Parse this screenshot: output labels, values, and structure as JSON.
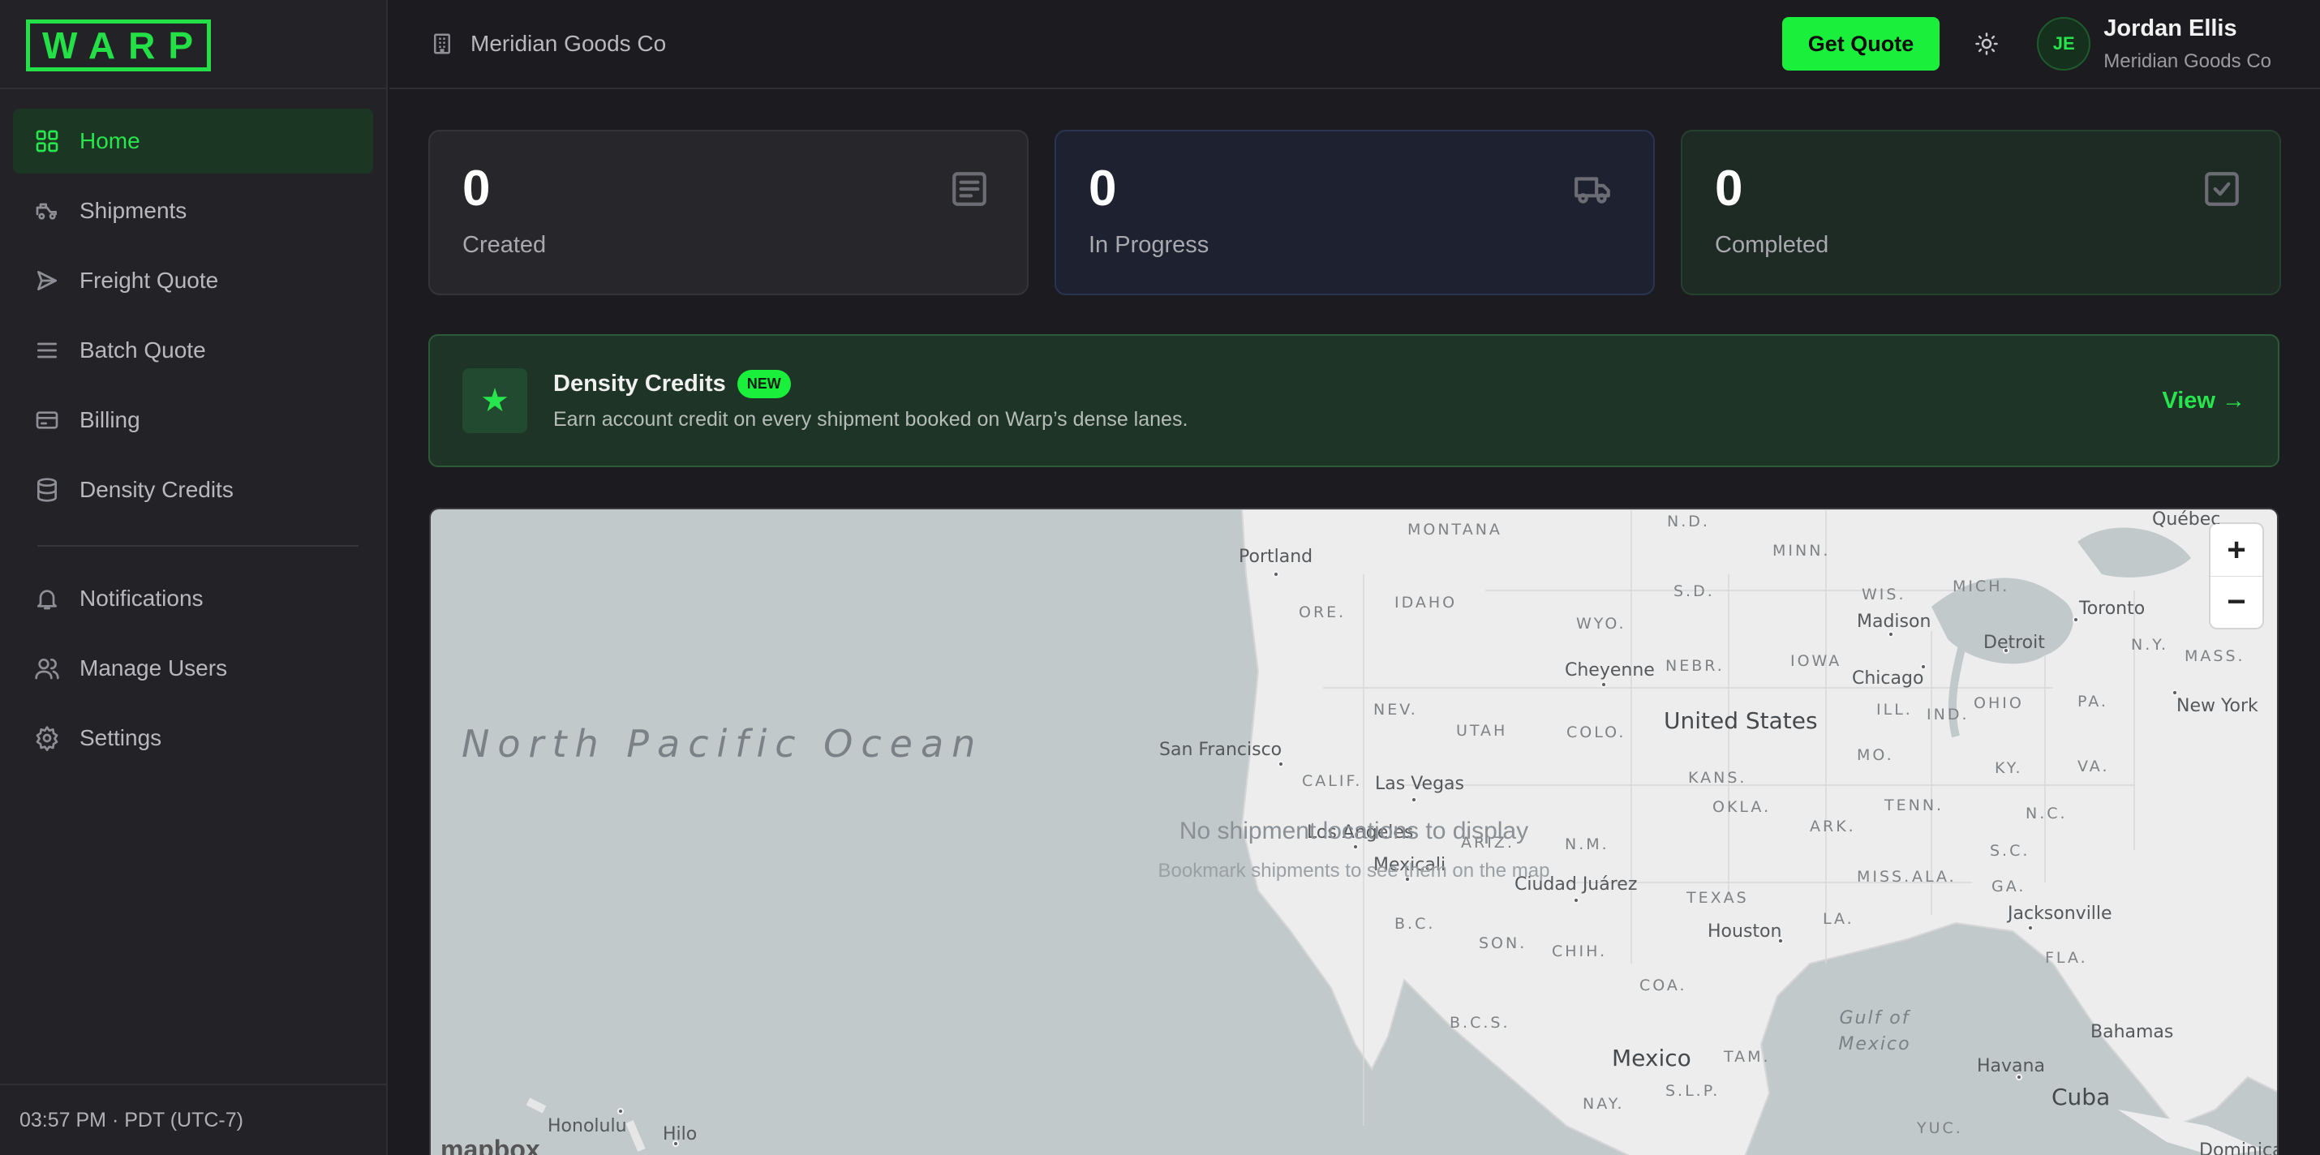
{
  "app": {
    "logo_text": "WARP"
  },
  "sidebar": {
    "items": [
      {
        "label": "Home",
        "icon": "grid-icon",
        "active": true
      },
      {
        "label": "Shipments",
        "icon": "truck-icon"
      },
      {
        "label": "Freight Quote",
        "icon": "send-icon"
      },
      {
        "label": "Batch Quote",
        "icon": "list-icon"
      },
      {
        "label": "Billing",
        "icon": "credit-card-icon"
      },
      {
        "label": "Density Credits",
        "icon": "database-icon"
      },
      {
        "label": "Notifications",
        "icon": "bell-icon"
      },
      {
        "label": "Manage Users",
        "icon": "users-icon"
      },
      {
        "label": "Settings",
        "icon": "gear-icon"
      }
    ],
    "footer_time": "03:57 PM · PDT (UTC-7)"
  },
  "header": {
    "org_name": "Meridian Goods Co",
    "quote_button": "Get Quote",
    "user": {
      "initials": "JE",
      "name": "Jordan Ellis",
      "org": "Meridian Goods Co"
    }
  },
  "stats": [
    {
      "value": "0",
      "label": "Created",
      "icon": "document-icon"
    },
    {
      "value": "0",
      "label": "In Progress",
      "icon": "truck-icon"
    },
    {
      "value": "0",
      "label": "Completed",
      "icon": "check-square-icon"
    }
  ],
  "banner": {
    "title": "Density Credits",
    "badge": "NEW",
    "subtitle": "Earn account credit on every shipment booked on Warp’s dense lanes.",
    "link": "View →"
  },
  "map": {
    "empty_title": "No shipment locations to display",
    "empty_subtitle": "Bookmark shipments to see them on the map",
    "ocean": "North Pacific Ocean",
    "gulf": "Gulf of Mexico",
    "countries": [
      "United States",
      "Mexico",
      "Cuba"
    ],
    "states": [
      "MONTANA",
      "N.D.",
      "MINN.",
      "IDAHO",
      "ORE.",
      "WYO.",
      "S.D.",
      "WIS.",
      "MICH.",
      "N.Y.",
      "MASS.",
      "IOWA",
      "NEBR.",
      "NEV.",
      "UTAH",
      "COLO.",
      "ILL.",
      "IND.",
      "OHIO",
      "PA.",
      "CALIF.",
      "KANS.",
      "MO.",
      "KY.",
      "VA.",
      "ARIZ.",
      "N.M.",
      "OKLA.",
      "TENN.",
      "N.C.",
      "ARK.",
      "S.C.",
      "TEXAS",
      "MISS.",
      "ALA.",
      "GA.",
      "LA.",
      "FLA.",
      "B.C.",
      "SON.",
      "CHIH.",
      "COA.",
      "B.C.S.",
      "TAM.",
      "S.L.P.",
      "NAY.",
      "YUC."
    ],
    "cities": [
      "Portland",
      "Cheyenne",
      "Madison",
      "Detroit",
      "Toronto",
      "Chicago",
      "New York",
      "San Francisco",
      "Las Vegas",
      "Los Angeles",
      "Mexicali",
      "Ciudad Juárez",
      "Houston",
      "Jacksonville",
      "Havana",
      "Bahamas",
      "Honolulu",
      "Hilo",
      "Québec",
      "Dominica"
    ],
    "zoom_in": "+",
    "zoom_out": "−",
    "attribution": "mapbox"
  }
}
